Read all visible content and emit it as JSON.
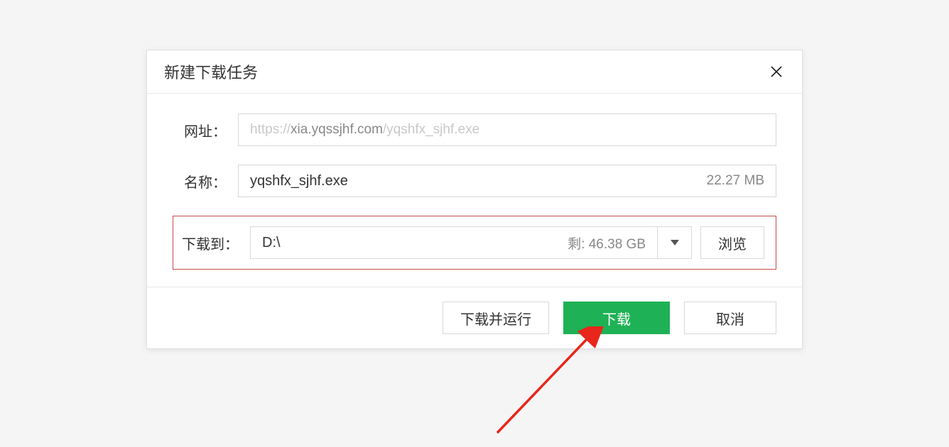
{
  "dialog": {
    "title": "新建下载任务",
    "url": {
      "label": "网址：",
      "protocol": "https://",
      "domain": "xia.yqssjhf.com",
      "path": "/yqshfx_sjhf.exe"
    },
    "name": {
      "label": "名称：",
      "value": "yqshfx_sjhf.exe",
      "size": "22.27 MB"
    },
    "destination": {
      "label": "下载到：",
      "path": "D:\\",
      "remaining_label": "剩: 46.38 GB",
      "browse_label": "浏览"
    },
    "actions": {
      "download_and_run": "下载并运行",
      "download": "下载",
      "cancel": "取消"
    }
  }
}
